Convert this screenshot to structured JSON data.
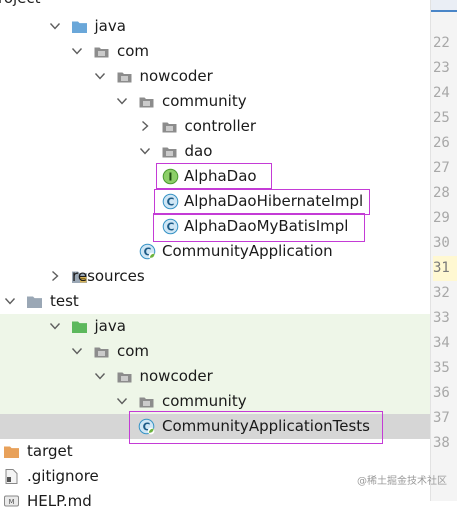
{
  "header": {
    "title": "roject"
  },
  "tree": [
    {
      "label": "java",
      "type": "folder-source",
      "arrow": "down",
      "depth": 1
    },
    {
      "label": "com",
      "type": "package",
      "arrow": "down",
      "depth": 2
    },
    {
      "label": "nowcoder",
      "type": "package",
      "arrow": "down",
      "depth": 3
    },
    {
      "label": "community",
      "type": "package",
      "arrow": "down",
      "depth": 4
    },
    {
      "label": "controller",
      "type": "package",
      "arrow": "right",
      "depth": 5
    },
    {
      "label": "dao",
      "type": "package",
      "arrow": "down",
      "depth": 5
    },
    {
      "label": "AlphaDao",
      "type": "interface",
      "arrow": "none",
      "depth": 6,
      "icon_letter": "I"
    },
    {
      "label": "AlphaDaoHibernateImpl",
      "type": "class",
      "arrow": "none",
      "depth": 6,
      "icon_letter": "C"
    },
    {
      "label": "AlphaDaoMyBatisImpl",
      "type": "class",
      "arrow": "none",
      "depth": 6,
      "icon_letter": "C"
    },
    {
      "label": "CommunityApplication",
      "type": "spring-class",
      "arrow": "none",
      "depth": 5,
      "icon_letter": "C"
    },
    {
      "label": "resources",
      "type": "folder-resources",
      "arrow": "right",
      "depth": 1
    },
    {
      "label": "test",
      "type": "folder",
      "arrow": "down",
      "depth": 0
    },
    {
      "label": "java",
      "type": "folder-test",
      "arrow": "down",
      "depth": 1
    },
    {
      "label": "com",
      "type": "package",
      "arrow": "down",
      "depth": 2
    },
    {
      "label": "nowcoder",
      "type": "package",
      "arrow": "down",
      "depth": 3
    },
    {
      "label": "community",
      "type": "package",
      "arrow": "down",
      "depth": 4
    },
    {
      "label": "CommunityApplicationTests",
      "type": "spring-class",
      "arrow": "none",
      "depth": 5,
      "icon_letter": "C"
    },
    {
      "label": "target",
      "type": "folder-excluded",
      "arrow": "none",
      "depth": -1
    },
    {
      "label": ".gitignore",
      "type": "file",
      "arrow": "none",
      "depth": -1
    },
    {
      "label": "HELP.md",
      "type": "markdown",
      "arrow": "none",
      "depth": -1
    }
  ],
  "line_numbers": [
    "22",
    "23",
    "24",
    "25",
    "26",
    "27",
    "28",
    "29",
    "30",
    "31",
    "32",
    "33",
    "34",
    "35",
    "36",
    "37",
    "38"
  ],
  "active_line": "31",
  "watermark": "@稀土掘金技术社区",
  "colors": {
    "highlight_box": "#c43bd6",
    "test_bg": "#eef6e8",
    "selection_bg": "#d6d6d6",
    "package_icon": "#8c8c8c",
    "folder_source": "#6aa7d9",
    "folder_test": "#5cb85c",
    "folder_excluded": "#e8a15a",
    "class_icon": "#3592c4",
    "interface_icon": "#62b543"
  }
}
